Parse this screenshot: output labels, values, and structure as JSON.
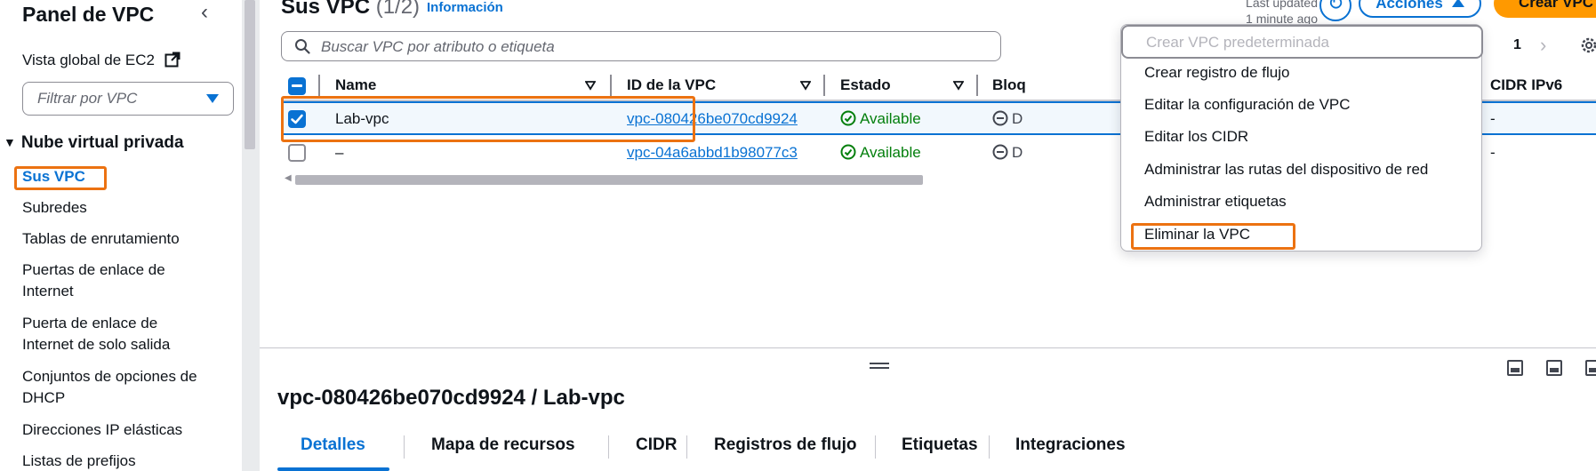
{
  "colors": {
    "accent": "#0972d3",
    "primary_button": "#ff9900",
    "highlight_box": "#ec7211",
    "status_ok": "#037f0c"
  },
  "sidebar": {
    "title": "Panel de VPC",
    "global_link": "Vista global de EC2",
    "filter_placeholder": "Filtrar por VPC",
    "section": "Nube virtual privada",
    "items": [
      {
        "label": "Sus VPC",
        "active": true
      },
      {
        "label": "Subredes"
      },
      {
        "label": "Tablas de enrutamiento"
      },
      {
        "label": "Puertas de enlace de Internet"
      },
      {
        "label": "Puerta de enlace de Internet de solo salida"
      },
      {
        "label": "Conjuntos de opciones de DHCP"
      },
      {
        "label": "Direcciones IP elásticas"
      },
      {
        "label": "Listas de prefijos"
      }
    ]
  },
  "header": {
    "title": "Sus VPC",
    "count": "(1/2)",
    "info": "Información",
    "last_updated_label": "Last updated",
    "last_updated_value": "1 minute ago",
    "actions_label": "Acciones",
    "create_label": "Crear VPC"
  },
  "search": {
    "placeholder": "Buscar VPC por atributo o etiqueta"
  },
  "pagination": {
    "page": "1"
  },
  "table": {
    "columns": [
      "Name",
      "ID de la VPC",
      "Estado",
      "Bloq",
      "CIDR IPv6"
    ],
    "rows": [
      {
        "name": "Lab-vpc",
        "vpc_id": "vpc-080426be070cd9924",
        "status": "Available",
        "block": "D",
        "ipv6": "-",
        "selected": true
      },
      {
        "name": "–",
        "vpc_id": "vpc-04a6abbd1b98077c3",
        "status": "Available",
        "block": "D",
        "ipv6": "-",
        "selected": false
      }
    ]
  },
  "actions_menu": {
    "items": [
      {
        "label": "Crear VPC predeterminada",
        "disabled": true
      },
      {
        "label": "Crear registro de flujo"
      },
      {
        "label": "Editar la configuración de VPC"
      },
      {
        "label": "Editar los CIDR"
      },
      {
        "label": "Administrar las rutas del dispositivo de red"
      },
      {
        "label": "Administrar etiquetas"
      },
      {
        "label": "Eliminar la VPC",
        "highlighted": true
      }
    ]
  },
  "details": {
    "title": "vpc-080426be070cd9924 / Lab-vpc",
    "tabs": [
      "Detalles",
      "Mapa de recursos",
      "CIDR",
      "Registros de flujo",
      "Etiquetas",
      "Integraciones"
    ],
    "active_tab": "Detalles"
  }
}
